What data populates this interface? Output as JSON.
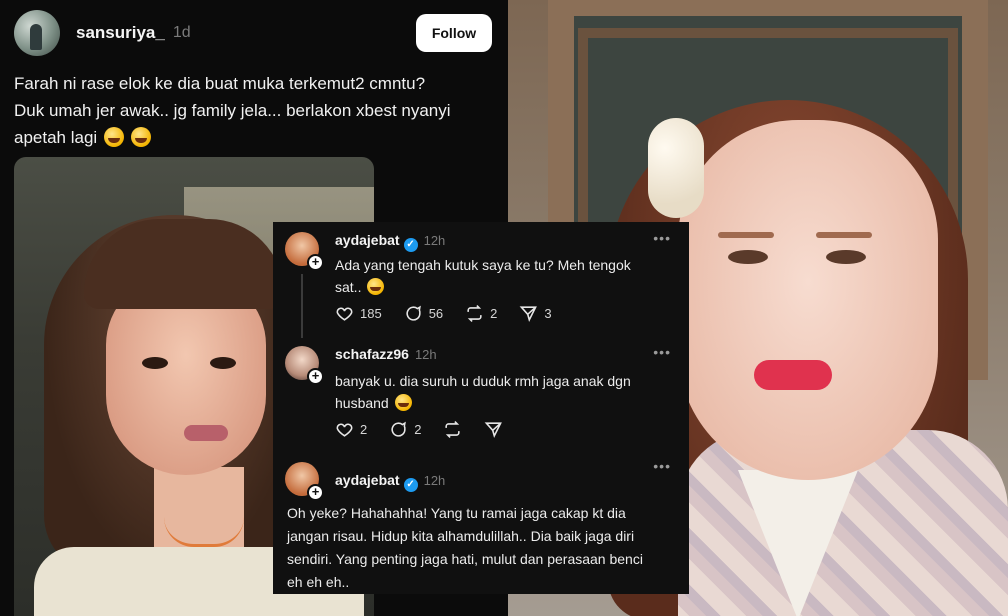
{
  "left_post": {
    "username": "sansuriya_",
    "time": "1d",
    "follow_label": "Follow",
    "text_lines": [
      "Farah ni rase elok ke dia buat muka terkemut2 cmntu?",
      "Duk umah jer awak.. jg family jela... berlakon xbest nyanyi",
      "apetah lagi"
    ]
  },
  "thread": {
    "post1": {
      "username": "aydajebat",
      "time": "12h",
      "text_lines": [
        "Ada yang tengah kutuk saya ke tu? Meh tengok",
        "sat.."
      ],
      "likes": "185",
      "comments": "56",
      "reposts": "2",
      "shares": "3"
    },
    "post2": {
      "username": "schafazz96",
      "time": "12h",
      "text_lines": [
        "banyak u. dia suruh u duduk rmh jaga anak dgn",
        "husband"
      ],
      "likes": "2",
      "comments": "2"
    },
    "post3": {
      "username": "aydajebat",
      "time": "12h",
      "text_lines": [
        "Oh yeke? Hahahahha! Yang tu ramai jaga cakap kt dia",
        "jangan risau. Hidup kita alhamdulillah.. Dia baik jaga diri",
        "sendiri. Yang penting jaga hati, mulut dan perasaan benci",
        "eh eh eh.."
      ]
    }
  },
  "icons": {
    "verified": "verified-badge-icon",
    "like": "heart-icon",
    "comment": "comment-icon",
    "repost": "repost-icon",
    "share": "share-icon",
    "more": "more-icon"
  },
  "colors": {
    "background": "#0b0b0b",
    "verified": "#1d9bf0",
    "follow_button": "#ffffff"
  }
}
